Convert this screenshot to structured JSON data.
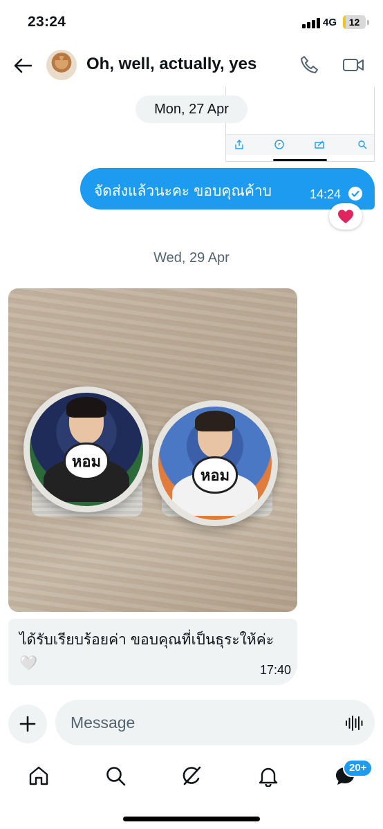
{
  "status_bar": {
    "time": "23:24",
    "network": "4G",
    "battery": "12"
  },
  "header": {
    "title": "Oh, well, actually, yes"
  },
  "colors": {
    "accent": "#1d9bf0",
    "bubble_received": "#eff3f4",
    "heart": "#e0245e"
  },
  "thread": {
    "date_1": "Mon, 27 Apr",
    "sent_message": {
      "text": "จัดส่งแล้วนะคะ ขอบคุณค้าบ",
      "time": "14:24",
      "reaction": "❤️"
    },
    "date_2": "Wed, 29 Apr",
    "photo_labels": {
      "left_badge": "หอม",
      "right_badge": "หอม"
    },
    "received_message": {
      "text": "ได้รับเรียบร้อยค่า ขอบคุณที่เป็นธุระให้ค่ะ 🤍",
      "time": "17:40"
    }
  },
  "composer": {
    "placeholder": "Message"
  },
  "nav": {
    "messages_badge": "20+"
  },
  "icons": [
    "back-arrow-icon",
    "phone-icon",
    "video-camera-icon",
    "share-icon",
    "compass-icon",
    "edit-icon",
    "search-icon",
    "check-icon",
    "heart-icon",
    "plus-icon",
    "voice-wave-icon",
    "home-icon",
    "grok-icon",
    "bell-icon",
    "messages-icon"
  ]
}
